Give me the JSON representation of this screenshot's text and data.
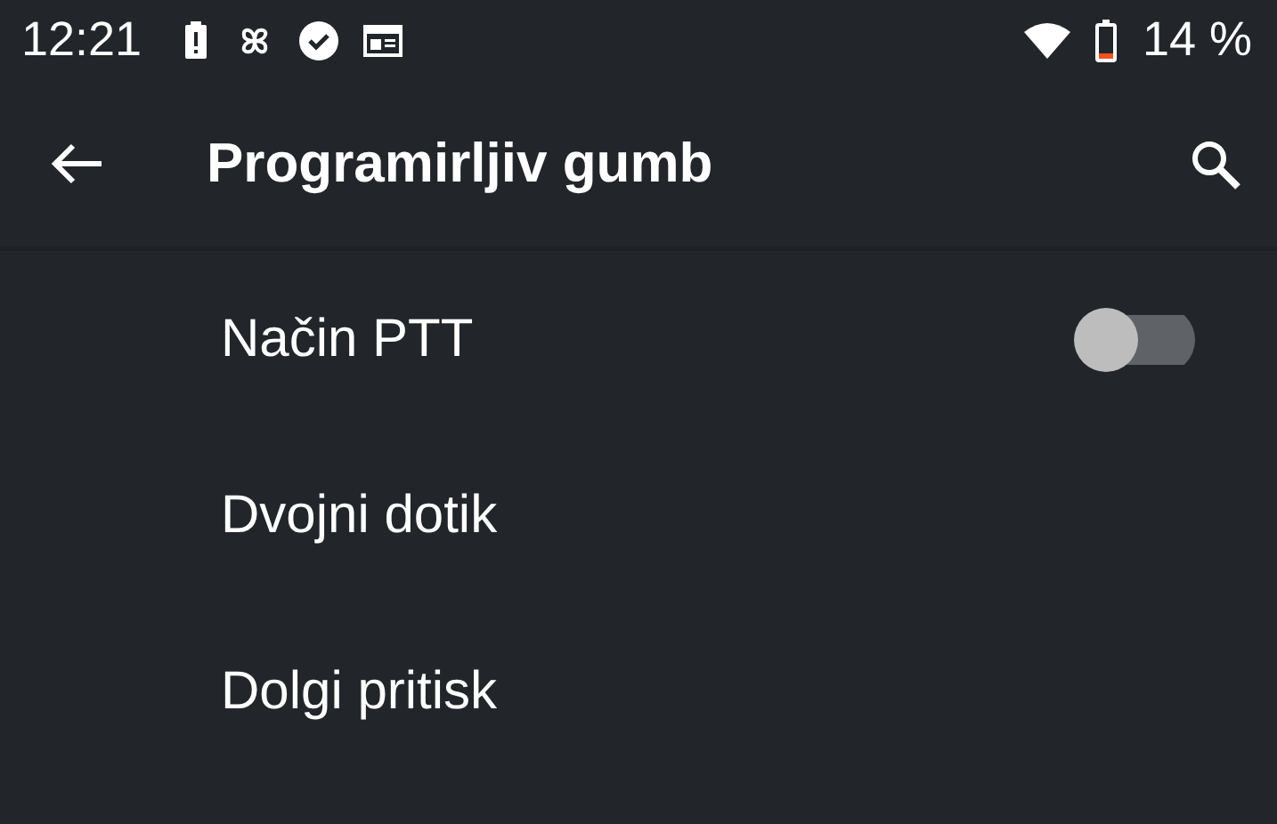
{
  "status_bar": {
    "time": "12:21",
    "battery_text": "14 %"
  },
  "app_bar": {
    "title": "Programirljiv gumb"
  },
  "items": [
    {
      "kind": "switch",
      "label": "Način PTT",
      "on": false
    },
    {
      "kind": "plain",
      "label": "Dvojni dotik"
    },
    {
      "kind": "plain",
      "label": "Dolgi pritisk"
    }
  ]
}
